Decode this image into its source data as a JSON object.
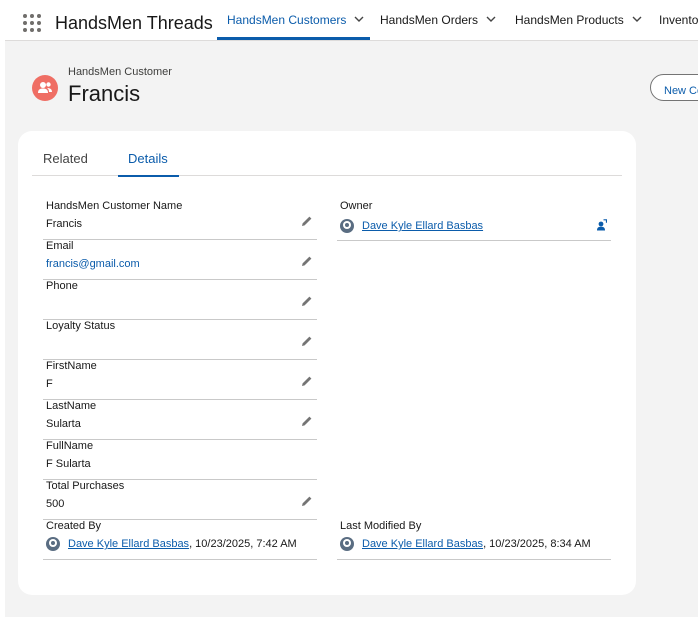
{
  "app": {
    "name": "HandsMen Threads"
  },
  "nav": {
    "tabs": [
      {
        "label": "HandsMen Customers"
      },
      {
        "label": "HandsMen Orders"
      },
      {
        "label": "HandsMen Products"
      },
      {
        "label": "Inventory"
      }
    ]
  },
  "record": {
    "type_label": "HandsMen Customer",
    "name": "Francis",
    "new_button_label": "New Contact"
  },
  "tabs": {
    "related": "Related",
    "details": "Details"
  },
  "fields": {
    "customer_name": {
      "label": "HandsMen Customer Name",
      "value": "Francis"
    },
    "email": {
      "label": "Email",
      "value": "francis@gmail.com"
    },
    "phone": {
      "label": "Phone",
      "value": ""
    },
    "loyalty_status": {
      "label": "Loyalty Status",
      "value": ""
    },
    "first_name": {
      "label": "FirstName",
      "value": "F"
    },
    "last_name": {
      "label": "LastName",
      "value": "Sularta"
    },
    "full_name": {
      "label": "FullName",
      "value": "F Sularta"
    },
    "total_purchases": {
      "label": "Total Purchases",
      "value": "500"
    },
    "owner": {
      "label": "Owner",
      "value": "Dave Kyle Ellard Basbas"
    },
    "created_by": {
      "label": "Created By",
      "user": "Dave Kyle Ellard Basbas",
      "timestamp": ", 10/23/2025, 7:42 AM"
    },
    "last_modified_by": {
      "label": "Last Modified By",
      "user": "Dave Kyle Ellard Basbas",
      "timestamp": ", 10/23/2025, 8:34 AM"
    }
  },
  "icons": {
    "app_launcher": "waffle-icon",
    "record": "customer-icon",
    "edit": "pencil-icon",
    "change_owner": "change-owner-icon",
    "user": "user-avatar-icon",
    "dropdown": "chevron-down-icon"
  },
  "colors": {
    "accent": "#0b5cab",
    "record_icon": "#ef6e64"
  }
}
